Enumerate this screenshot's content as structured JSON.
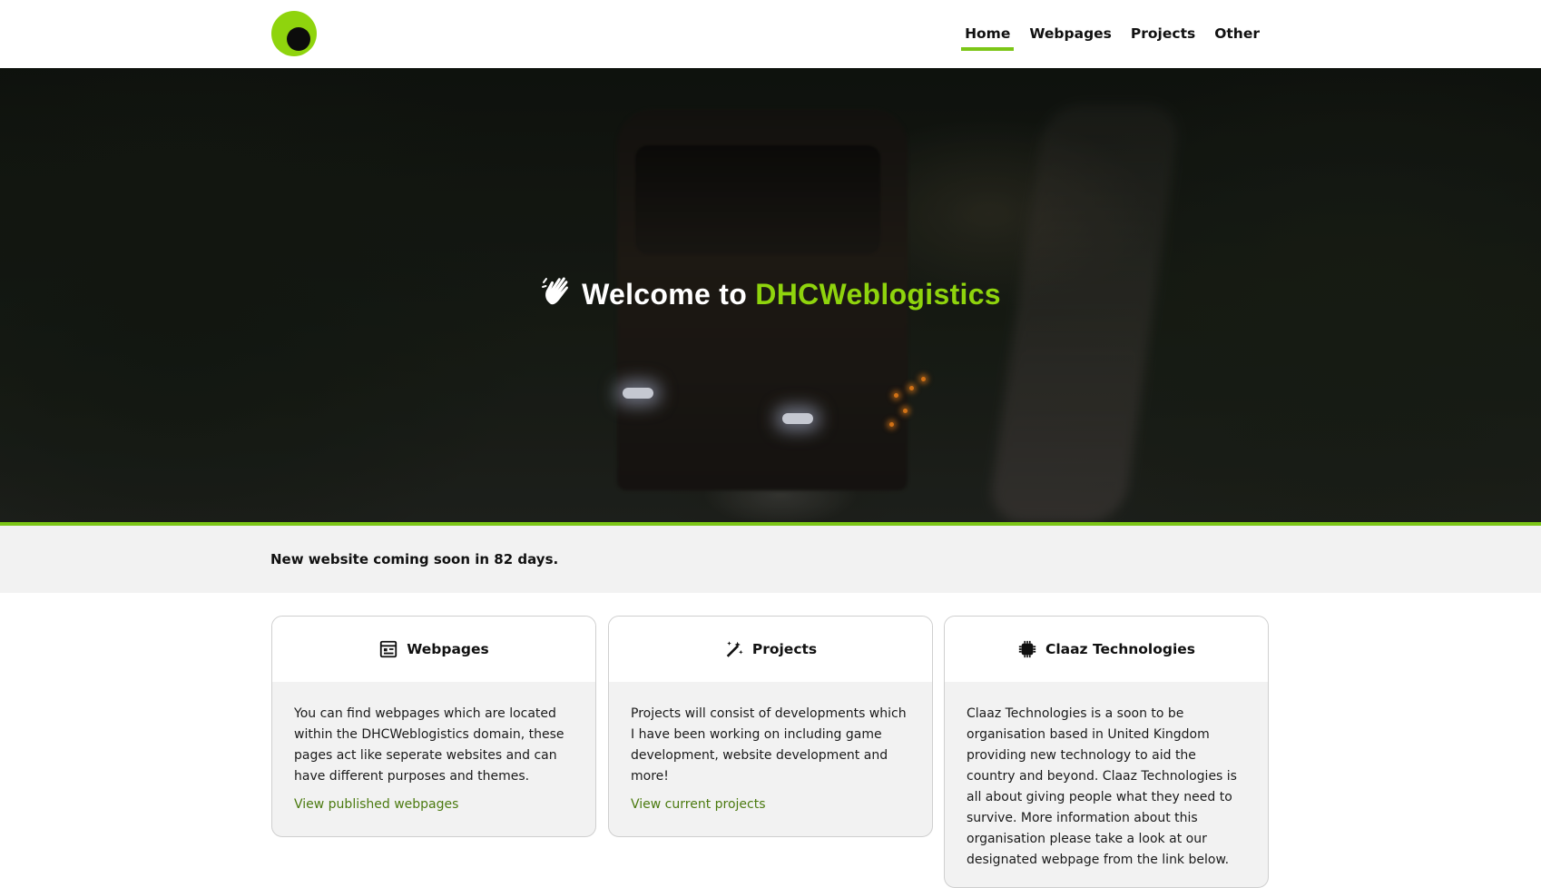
{
  "header": {
    "logo": "dhcweblogistics-logo",
    "nav": [
      {
        "label": "Home",
        "active": true
      },
      {
        "label": "Webpages",
        "active": false
      },
      {
        "label": "Projects",
        "active": false
      },
      {
        "label": "Other",
        "active": false
      }
    ]
  },
  "hero": {
    "icon": "waving-hand-icon",
    "title_prefix": "Welcome to ",
    "title_brand": "DHCWeblogistics"
  },
  "notice": {
    "text": "New website coming soon in 82 days."
  },
  "cards": [
    {
      "icon": "newspaper-icon",
      "title": "Webpages",
      "body": "You can find webpages which are located within the DHCWeblogistics domain, these pages act like seperate websites and can have different purposes and themes.",
      "link": "View published webpages"
    },
    {
      "icon": "magic-wand-icon",
      "title": "Projects",
      "body": "Projects will consist of developments which I have been working on including game development, website development and more!",
      "link": "View current projects"
    },
    {
      "icon": "chip-icon",
      "title": "Claaz Technologies",
      "body": "Claaz Technologies is a soon to be organisation based in United Kingdom providing new technology to aid the country and beyond. Claaz Technologies is all about giving people what they need to survive. More information about this organisation please take a look at our designated webpage from the link below."
    }
  ],
  "colors": {
    "accent": "#7cc617",
    "brand_text": "#8fd40d",
    "link": "#4b7a0f",
    "notice_bg": "#f2f2f2"
  }
}
